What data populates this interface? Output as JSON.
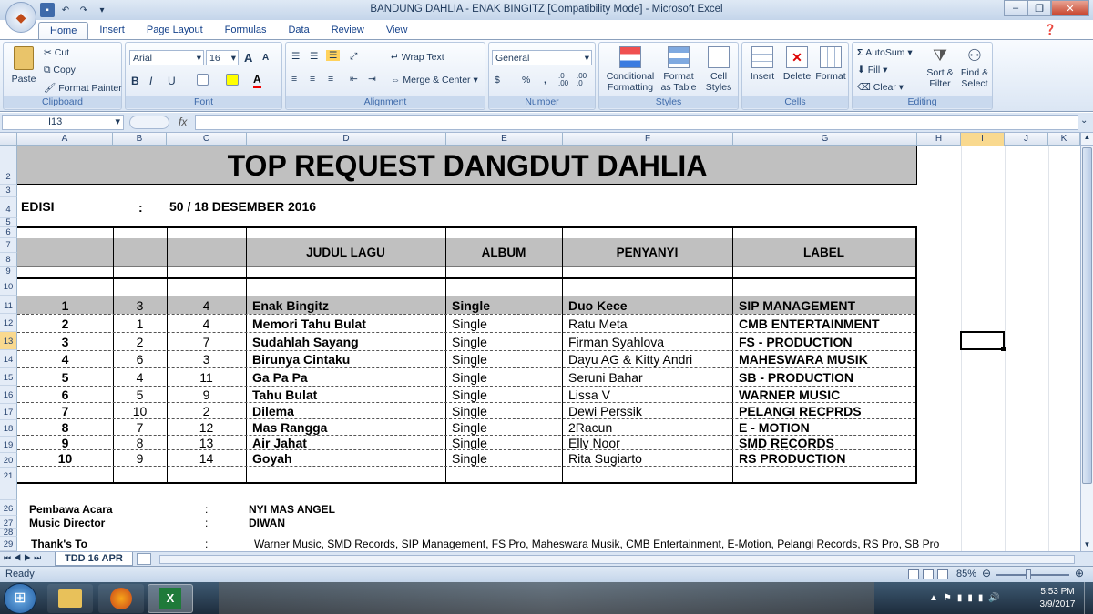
{
  "window": {
    "title": "BANDUNG DAHLIA - ENAK BINGITZ  [Compatibility Mode] - Microsoft Excel",
    "minimize": "–",
    "maximize": "❐",
    "close": "✕"
  },
  "ribbon_tabs": [
    "Home",
    "Insert",
    "Page Layout",
    "Formulas",
    "Data",
    "Review",
    "View"
  ],
  "ribbon": {
    "clipboard": {
      "paste": "Paste",
      "cut": "Cut",
      "copy": "Copy",
      "format_painter": "Format Painter",
      "label": "Clipboard"
    },
    "font": {
      "name": "Arial",
      "size": "16",
      "label": "Font",
      "grow": "A",
      "shrink": "A",
      "bold": "B",
      "italic": "I",
      "underline": "U"
    },
    "alignment": {
      "wrap_text": "Wrap Text",
      "merge_center": "Merge & Center",
      "label": "Alignment"
    },
    "number": {
      "format": "General",
      "currency": "$",
      "percent": "%",
      "comma": ",",
      "inc_decimal": ".0 .00",
      "dec_decimal": ".00 .0",
      "label": "Number"
    },
    "styles": {
      "conditional": "Conditional Formatting",
      "conditional_l1": "Conditional",
      "conditional_l2": "Formatting",
      "format_table_l1": "Format",
      "format_table_l2": "as Table",
      "cell_styles_l1": "Cell",
      "cell_styles_l2": "Styles",
      "label": "Styles"
    },
    "cells": {
      "insert": "Insert",
      "delete": "Delete",
      "format": "Format",
      "label": "Cells"
    },
    "editing": {
      "autosum": "AutoSum",
      "fill": "Fill",
      "clear": "Clear",
      "sort_l1": "Sort &",
      "sort_l2": "Filter",
      "find_l1": "Find &",
      "find_l2": "Select",
      "label": "Editing"
    }
  },
  "formula_bar": {
    "name_box": "I13",
    "fx": "fx",
    "formula": ""
  },
  "columns": [
    "A",
    "B",
    "C",
    "D",
    "E",
    "F",
    "G",
    "H",
    "I",
    "J",
    "K"
  ],
  "rows": [
    "2",
    "3",
    "4",
    "5",
    "6",
    "7",
    "8",
    "9",
    "10",
    "11",
    "12",
    "13",
    "14",
    "15",
    "16",
    "17",
    "18",
    "19",
    "20",
    "21",
    "26",
    "27",
    "28",
    "29"
  ],
  "sheet": {
    "title": "TOP REQUEST DANGDUT DAHLIA",
    "edisi_label": "EDISI",
    "colon": ":",
    "edisi_value": "50  /  18   DESEMBER  2016",
    "headers": {
      "judul": "JUDUL LAGU",
      "album": "ALBUM",
      "penyanyi": "PENYANYI",
      "label": "LABEL"
    },
    "entries": [
      {
        "a": "1",
        "b": "3",
        "c": "4",
        "judul": "Enak Bingitz",
        "album": "Single",
        "penyanyi": "Duo Kece",
        "label": "SIP MANAGEMENT"
      },
      {
        "a": "2",
        "b": "1",
        "c": "4",
        "judul": "Memori Tahu Bulat",
        "album": "Single",
        "penyanyi": "Ratu Meta",
        "label": "CMB ENTERTAINMENT"
      },
      {
        "a": "3",
        "b": "2",
        "c": "7",
        "judul": "Sudahlah Sayang",
        "album": "Single",
        "penyanyi": "Firman Syahlova",
        "label": "FS - PRODUCTION"
      },
      {
        "a": "4",
        "b": "6",
        "c": "3",
        "judul": "Birunya Cintaku",
        "album": "Single",
        "penyanyi": "Dayu AG & Kitty Andri",
        "label": "MAHESWARA MUSIK"
      },
      {
        "a": "5",
        "b": "4",
        "c": "11",
        "judul": "Ga Pa Pa",
        "album": "Single",
        "penyanyi": "Seruni Bahar",
        "label": "SB - PRODUCTION"
      },
      {
        "a": "6",
        "b": "5",
        "c": "9",
        "judul": "Tahu Bulat",
        "album": "Single",
        "penyanyi": "Lissa V",
        "label": "WARNER MUSIC"
      },
      {
        "a": "7",
        "b": "10",
        "c": "2",
        "judul": "Dilema",
        "album": "Single",
        "penyanyi": "Dewi Perssik",
        "label": "PELANGI RECPRDS"
      },
      {
        "a": "8",
        "b": "7",
        "c": "12",
        "judul": "Mas Rangga",
        "album": "Single",
        "penyanyi": "2Racun",
        "label": "E - MOTION"
      },
      {
        "a": "9",
        "b": "8",
        "c": "13",
        "judul": "Air Jahat",
        "album": "Single",
        "penyanyi": "Elly Noor",
        "label": "SMD RECORDS"
      },
      {
        "a": "10",
        "b": "9",
        "c": "14",
        "judul": "Goyah",
        "album": "Single",
        "penyanyi": "Rita Sugiarto",
        "label": "RS PRODUCTION"
      }
    ],
    "pembawa_label": "Pembawa Acara",
    "pembawa_value": "NYI MAS ANGEL",
    "director_label": "Music Director",
    "director_value": "DIWAN",
    "thanks_label": "Thank's  To",
    "thanks_value": "Warner Music, SMD Records, SIP Management, FS Pro, Maheswara Musik, CMB Entertainment, E-Motion, Pelangi Records, RS Pro, SB Pro"
  },
  "sheet_tab": "TDD 16 APR",
  "status": {
    "ready": "Ready",
    "zoom": "85%"
  },
  "clock": {
    "time": "5:53 PM",
    "date": "3/9/2017"
  }
}
